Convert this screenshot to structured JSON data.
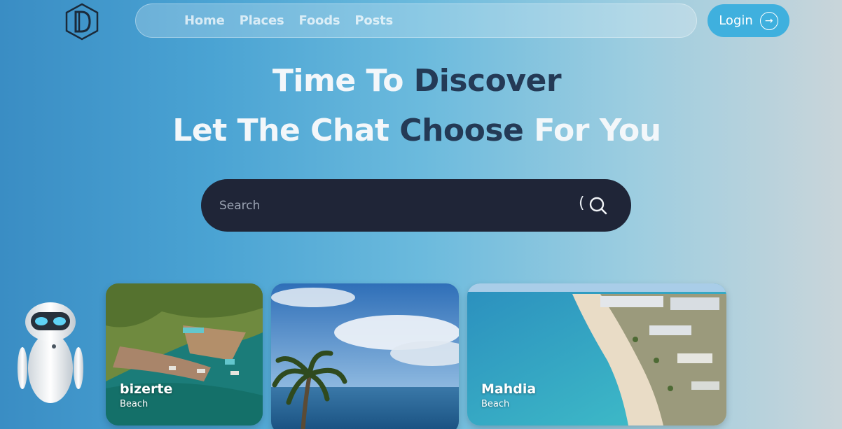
{
  "brand": {
    "logo_icon": "hexagon-d-logo"
  },
  "nav": {
    "items": [
      {
        "label": "Home"
      },
      {
        "label": "Places"
      },
      {
        "label": "Foods"
      },
      {
        "label": "Posts"
      }
    ]
  },
  "login": {
    "label": "Login",
    "icon": "arrow-right-circle-icon"
  },
  "hero": {
    "line1_a": "Time To ",
    "line1_b": "Discover",
    "line2_a": "Let The Chat ",
    "line2_b": "Choose",
    "line2_c": " For You"
  },
  "search": {
    "placeholder": "Search",
    "paren": "(",
    "icon": "search-icon"
  },
  "cards": [
    {
      "title": "bizerte",
      "subtitle": "Beach"
    },
    {
      "title": "",
      "subtitle": ""
    },
    {
      "title": "Mahdia",
      "subtitle": "Beach"
    }
  ],
  "colors": {
    "accent": "#3fb0de",
    "dark_text": "#243a56",
    "search_bg": "#1f2537"
  }
}
